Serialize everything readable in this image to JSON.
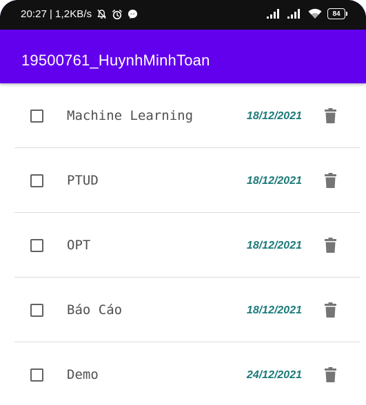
{
  "status_bar": {
    "time": "20:27",
    "speed": "1,2KB/s",
    "battery": "84",
    "icons": [
      "mute-notification-icon",
      "alarm-icon",
      "messenger-icon",
      "signal-1-icon",
      "signal-2-icon",
      "wifi-icon",
      "battery-icon"
    ]
  },
  "app_bar": {
    "title": "19500761_HuynhMinhToan",
    "color": "#6200ee"
  },
  "tasks": [
    {
      "name": "Machine Learning",
      "date": "18/12/2021",
      "checked": false
    },
    {
      "name": "PTUD",
      "date": "18/12/2021",
      "checked": false
    },
    {
      "name": "OPT",
      "date": "18/12/2021",
      "checked": false
    },
    {
      "name": "Báo Cáo",
      "date": "18/12/2021",
      "checked": false
    },
    {
      "name": "Demo",
      "date": "24/12/2021",
      "checked": false
    }
  ],
  "colors": {
    "date": "#1c7a7a",
    "task_text": "#4f4f4f",
    "delete_icon": "#757575"
  }
}
